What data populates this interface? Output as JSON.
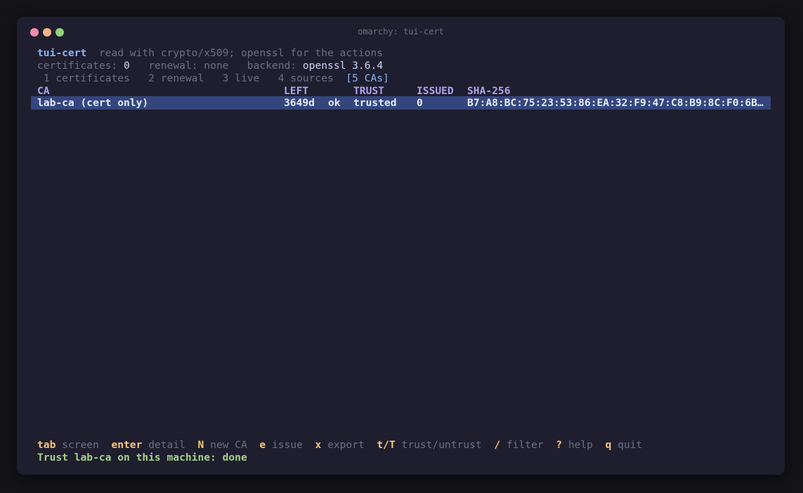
{
  "window": {
    "title": "omarchy: tui-cert"
  },
  "header": {
    "app_name": "tui-cert",
    "tagline": "read with crypto/x509; openssl for the actions"
  },
  "status": {
    "certificates_label": "certificates:",
    "certificates_value": "0",
    "renewal_label": "renewal:",
    "renewal_value": "none",
    "backend_label": "backend:",
    "backend_value": "openssl 3.6.4"
  },
  "tabs": [
    {
      "label": "1 certificates",
      "active": false
    },
    {
      "label": "2 renewal",
      "active": false
    },
    {
      "label": "3 live",
      "active": false
    },
    {
      "label": "4 sources",
      "active": false
    },
    {
      "label": "[5 CAs]",
      "active": true
    }
  ],
  "table": {
    "columns": [
      "CA",
      "LEFT",
      "TRUST",
      "ISSUED",
      "SHA-256"
    ],
    "rows": [
      {
        "ca": "lab-ca (cert only)",
        "left": "3649d",
        "left_status": "ok",
        "trust": "trusted",
        "issued": "0",
        "sha256": "B7:A8:BC:75:23:53:86:EA:32:F9:47:C8:B9:8C:F0:6B…",
        "selected": true
      }
    ]
  },
  "keybar": [
    {
      "key": "tab",
      "action": "screen"
    },
    {
      "key": "enter",
      "action": "detail"
    },
    {
      "key": "N",
      "action": "new CA"
    },
    {
      "key": "e",
      "action": "issue"
    },
    {
      "key": "x",
      "action": "export"
    },
    {
      "key": "t/T",
      "action": "trust/untrust"
    },
    {
      "key": "/",
      "action": "filter"
    },
    {
      "key": "?",
      "action": "help"
    },
    {
      "key": "q",
      "action": "quit"
    }
  ],
  "message": "Trust lab-ca on this machine: done",
  "colors": {
    "background": "#1e1e2e",
    "selection": "#34467e",
    "accent_blue": "#89b4fa",
    "header_purple": "#b4a0f0",
    "key_yellow": "#f9c47a",
    "success_green": "#a6d189"
  }
}
